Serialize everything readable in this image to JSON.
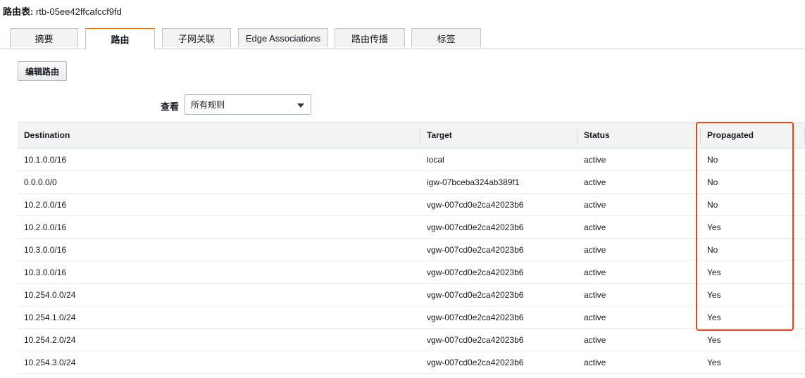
{
  "route_table": {
    "label": "路由表:",
    "id": "rtb-05ee42ffcafccf9fd"
  },
  "tabs": [
    {
      "label": "摘要"
    },
    {
      "label": "路由"
    },
    {
      "label": "子网关联"
    },
    {
      "label": "Edge Associations"
    },
    {
      "label": "路由传播"
    },
    {
      "label": "标签"
    }
  ],
  "active_tab": "路由",
  "edit_button": {
    "label": "编辑路由"
  },
  "filter": {
    "label": "查看",
    "selected": "所有规则"
  },
  "table": {
    "headers": {
      "destination": "Destination",
      "target": "Target",
      "status": "Status",
      "propagated": "Propagated"
    },
    "rows": [
      {
        "destination": "10.1.0.0/16",
        "target": "local",
        "status": "active",
        "propagated": "No"
      },
      {
        "destination": "0.0.0.0/0",
        "target": "igw-07bceba324ab389f1",
        "status": "active",
        "propagated": "No"
      },
      {
        "destination": "10.2.0.0/16",
        "target": "vgw-007cd0e2ca42023b6",
        "status": "active",
        "propagated": "No"
      },
      {
        "destination": "10.2.0.0/16",
        "target": "vgw-007cd0e2ca42023b6",
        "status": "active",
        "propagated": "Yes"
      },
      {
        "destination": "10.3.0.0/16",
        "target": "vgw-007cd0e2ca42023b6",
        "status": "active",
        "propagated": "No"
      },
      {
        "destination": "10.3.0.0/16",
        "target": "vgw-007cd0e2ca42023b6",
        "status": "active",
        "propagated": "Yes"
      },
      {
        "destination": "10.254.0.0/24",
        "target": "vgw-007cd0e2ca42023b6",
        "status": "active",
        "propagated": "Yes"
      },
      {
        "destination": "10.254.1.0/24",
        "target": "vgw-007cd0e2ca42023b6",
        "status": "active",
        "propagated": "Yes"
      },
      {
        "destination": "10.254.2.0/24",
        "target": "vgw-007cd0e2ca42023b6",
        "status": "active",
        "propagated": "Yes"
      },
      {
        "destination": "10.254.3.0/24",
        "target": "vgw-007cd0e2ca42023b6",
        "status": "active",
        "propagated": "Yes"
      }
    ]
  },
  "colors": {
    "link": "#0073bb",
    "status_active": "#1d8102",
    "highlight": "#e8441a",
    "tab_accent": "#ec7211"
  },
  "icons": {
    "dropdown": "caret-down-icon"
  }
}
